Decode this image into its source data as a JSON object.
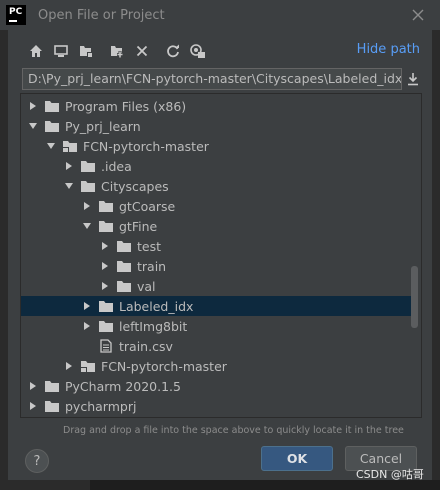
{
  "window": {
    "title": "Open File or Project",
    "logo_text": "PC"
  },
  "toolbar": {
    "buttons": [
      {
        "name": "home-icon"
      },
      {
        "name": "desktop-icon"
      },
      {
        "name": "project-folder-icon"
      },
      {
        "name": "new-folder-icon"
      },
      {
        "name": "delete-icon"
      },
      {
        "name": "refresh-icon"
      },
      {
        "name": "show-hidden-icon"
      }
    ],
    "hide_path": "Hide path"
  },
  "path": {
    "value": "D:\\Py_prj_learn\\FCN-pytorch-master\\Cityscapes\\Labeled_idx"
  },
  "tree": {
    "items": [
      {
        "label": "Program Files (x86)",
        "level": 0,
        "arrow": "right",
        "icon": "folder"
      },
      {
        "label": "Py_prj_learn",
        "level": 0,
        "arrow": "down",
        "icon": "folder"
      },
      {
        "label": "FCN-pytorch-master",
        "level": 1,
        "arrow": "down",
        "icon": "project"
      },
      {
        "label": ".idea",
        "level": 2,
        "arrow": "right",
        "icon": "folder"
      },
      {
        "label": "Cityscapes",
        "level": 2,
        "arrow": "down",
        "icon": "folder"
      },
      {
        "label": "gtCoarse",
        "level": 3,
        "arrow": "right",
        "icon": "folder"
      },
      {
        "label": "gtFine",
        "level": 3,
        "arrow": "down",
        "icon": "folder"
      },
      {
        "label": "test",
        "level": 4,
        "arrow": "right",
        "icon": "folder"
      },
      {
        "label": "train",
        "level": 4,
        "arrow": "right",
        "icon": "folder"
      },
      {
        "label": "val",
        "level": 4,
        "arrow": "right",
        "icon": "folder"
      },
      {
        "label": "Labeled_idx",
        "level": 3,
        "arrow": "right",
        "icon": "folder",
        "selected": true
      },
      {
        "label": "leftImg8bit",
        "level": 3,
        "arrow": "right",
        "icon": "folder"
      },
      {
        "label": "train.csv",
        "level": 3,
        "arrow": "none",
        "icon": "file"
      },
      {
        "label": "FCN-pytorch-master",
        "level": 2,
        "arrow": "right",
        "icon": "project"
      },
      {
        "label": "PyCharm 2020.1.5",
        "level": 0,
        "arrow": "right",
        "icon": "folder"
      },
      {
        "label": "pycharmprj",
        "level": 0,
        "arrow": "right",
        "icon": "folder"
      }
    ]
  },
  "hint": "Drag and drop a file into the space above to quickly locate it in the tree",
  "buttons": {
    "help": "?",
    "ok": "OK",
    "cancel": "Cancel"
  },
  "watermark": "CSDN @咕哥",
  "colors": {
    "accent": "#589df6",
    "selection": "#0d293e",
    "ok_button": "#365880"
  }
}
